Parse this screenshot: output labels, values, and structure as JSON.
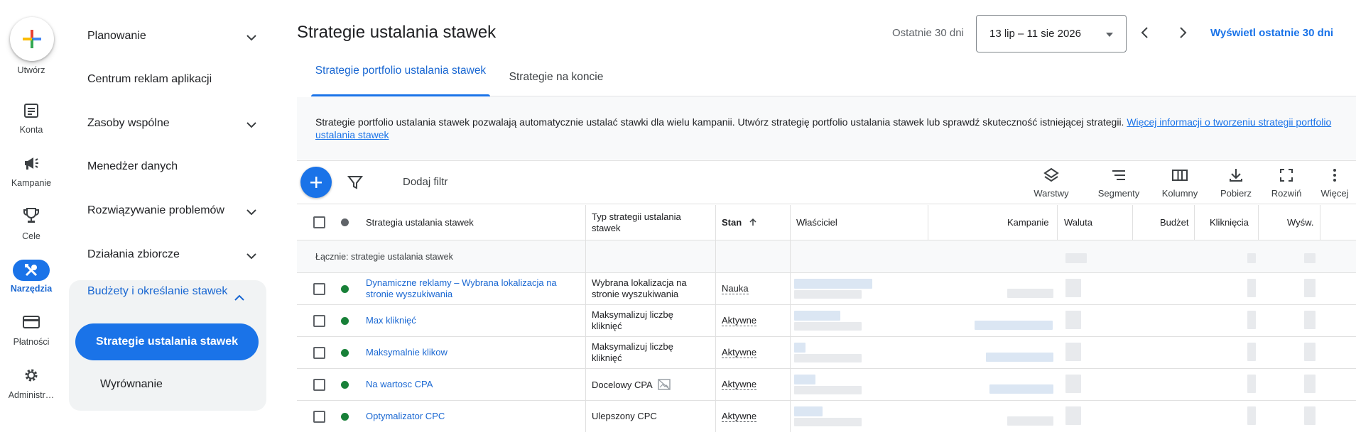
{
  "rail": {
    "create_label": "Utwórz",
    "items": [
      {
        "label": "Konta",
        "icon": "accounts-icon"
      },
      {
        "label": "Kampanie",
        "icon": "campaigns-icon"
      },
      {
        "label": "Cele",
        "icon": "goals-icon"
      },
      {
        "label": "Narzędzia",
        "icon": "tools-icon"
      },
      {
        "label": "Płatności",
        "icon": "billing-icon"
      },
      {
        "label": "Administr…",
        "icon": "admin-gear-icon"
      }
    ]
  },
  "nav": {
    "items": [
      {
        "label": "Planowanie"
      },
      {
        "label": "Centrum reklam aplikacji"
      },
      {
        "label": "Zasoby wspólne"
      },
      {
        "label": "Menedżer danych"
      },
      {
        "label": "Rozwiązywanie problemów"
      },
      {
        "label": "Działania zbiorcze"
      }
    ],
    "group_title": "Budżety i określanie stawek",
    "group_items": [
      "Strategie ustalania stawek",
      "Wyrównanie"
    ]
  },
  "header": {
    "title": "Strategie ustalania stawek",
    "period_label": "Ostatnie 30 dni",
    "date_range": "13 lip – 11 sie 2026",
    "show_link": "Wyświetl ostatnie 30 dni"
  },
  "tabs": [
    "Strategie portfolio ustalania stawek",
    "Strategie na koncie"
  ],
  "info": {
    "text": "Strategie portfolio ustalania stawek pozwalają automatycznie ustalać stawki dla wielu kampanii. Utwórz strategię portfolio ustalania stawek lub sprawdź skuteczność istniejącej strategii. ",
    "link": "Więcej informacji o tworzeniu strategii portfolio ustalania stawek"
  },
  "toolbar": {
    "add_filter": "Dodaj filtr",
    "tools": [
      "Warstwy",
      "Segmenty",
      "Kolumny",
      "Pobierz",
      "Rozwiń",
      "Więcej"
    ]
  },
  "table": {
    "headers": {
      "strategy": "Strategia ustalania stawek",
      "type": "Typ strategii ustalania stawek",
      "status": "Stan",
      "owner": "Właściciel",
      "campaigns": "Kampanie",
      "currency": "Waluta",
      "budget": "Budżet",
      "clicks": "Kliknięcia",
      "impressions": "Wyśw."
    },
    "total_label": "Łącznie: strategie ustalania stawek",
    "rows": [
      {
        "name": "Dynamiczne reklamy – Wybrana lokalizacja na stronie wyszukiwania",
        "type": "Wybrana lokalizacja na stronie wyszukiwania",
        "status": "Nauka"
      },
      {
        "name": "Max kliknięć",
        "type": "Maksymalizuj liczbę kliknięć",
        "status": "Aktywne"
      },
      {
        "name": "Maksymalnie klikow",
        "type": "Maksymalizuj liczbę kliknięć",
        "status": "Aktywne"
      },
      {
        "name": "Na wartosc CPA",
        "type": "Docelowy CPA",
        "status": "Aktywne"
      },
      {
        "name": "Optymalizator CPC",
        "type": "Ulepszony CPC",
        "status": "Aktywne"
      }
    ]
  },
  "colors": {
    "accent": "#1a73e8",
    "active_dot": "#188038",
    "neutral_dot": "#5f6368"
  }
}
